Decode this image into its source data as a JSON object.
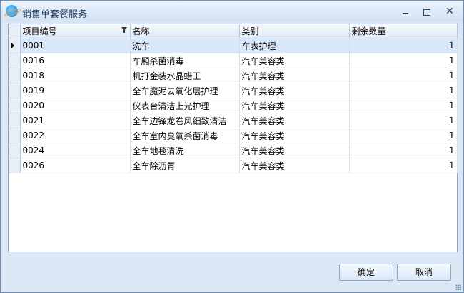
{
  "window": {
    "title": "销售单套餐服务"
  },
  "columns": [
    "项目编号",
    "名称",
    "类别",
    "剩余数量"
  ],
  "rows": [
    {
      "code": "0001",
      "name": "洗车",
      "category": "车表护理",
      "qty": "1"
    },
    {
      "code": "0016",
      "name": "车厢杀菌消毒",
      "category": "汽车美容类",
      "qty": "1"
    },
    {
      "code": "0018",
      "name": "机打金装水晶蜡王",
      "category": "汽车美容类",
      "qty": "1"
    },
    {
      "code": "0019",
      "name": "全车魔泥去氧化层护理",
      "category": "汽车美容类",
      "qty": "1"
    },
    {
      "code": "0020",
      "name": "仪表台清洁上光护理",
      "category": "汽车美容类",
      "qty": "1"
    },
    {
      "code": "0021",
      "name": "全车边锋龙卷风细致清洁",
      "category": "汽车美容类",
      "qty": "1"
    },
    {
      "code": "0022",
      "name": "全车室内臭氧杀菌消毒",
      "category": "汽车美容类",
      "qty": "1"
    },
    {
      "code": "0024",
      "name": "全车地毯清洗",
      "category": "汽车美容类",
      "qty": "1"
    },
    {
      "code": "0026",
      "name": "全车除沥青",
      "category": "汽车美容类",
      "qty": "1"
    }
  ],
  "buttons": {
    "ok": "确定",
    "cancel": "取消"
  }
}
